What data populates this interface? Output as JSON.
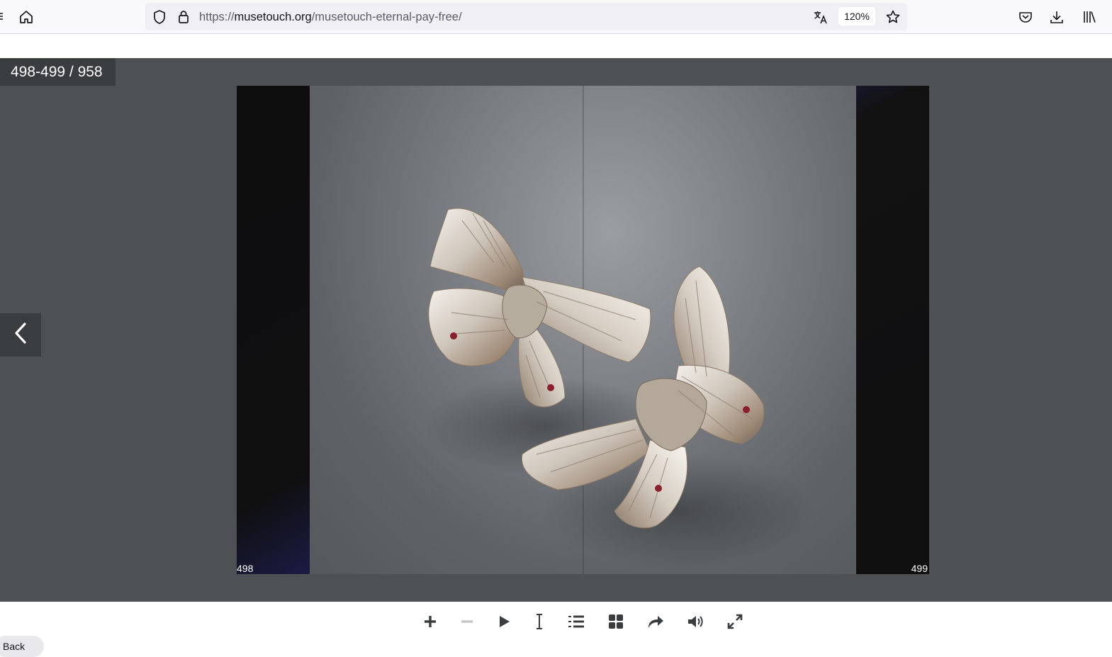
{
  "browser": {
    "url_scheme": "https://",
    "url_domain": "musetouch.org",
    "url_path": "/musetouch-eternal-pay-free/",
    "zoom": "120%",
    "icons": [
      "home-icon",
      "shield-icon",
      "lock-icon",
      "translate-icon",
      "star-icon",
      "pocket-icon",
      "download-icon",
      "library-icon"
    ]
  },
  "viewer": {
    "page_counter": "498-499 / 958",
    "left_page_number": "498",
    "right_page_number": "499",
    "photo_subject": "two silver butterfly brooches with red stones"
  },
  "controls": {
    "icons": [
      "zoom-in-icon",
      "zoom-out-icon",
      "play-icon",
      "text-select-icon",
      "table-of-contents-icon",
      "thumbnails-icon",
      "share-icon",
      "sound-icon",
      "fullscreen-icon"
    ]
  },
  "colors": {
    "viewer_background": "#4d5154",
    "counter_background": "#3a3d40",
    "page_side_blue": "#23255f"
  },
  "footer_pill_label": "Back"
}
